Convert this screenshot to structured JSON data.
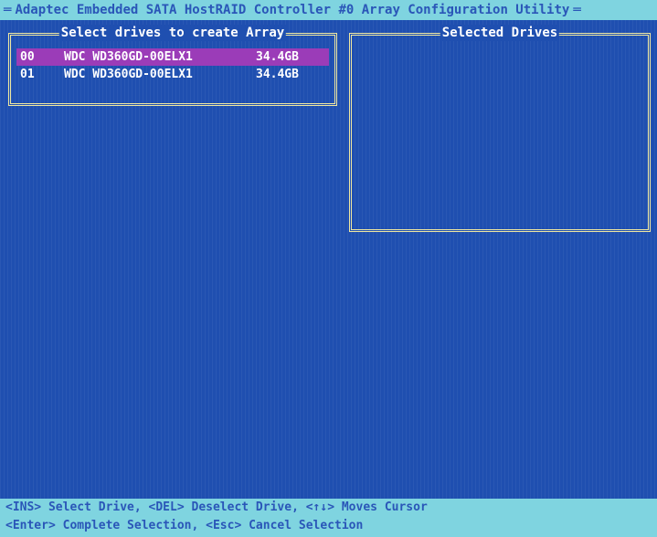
{
  "title_bar": {
    "text": "Adaptec Embedded SATA HostRAID Controller #0 Array Configuration Utility"
  },
  "left_panel": {
    "title": "Select drives to create Array",
    "drives": [
      {
        "id": "00",
        "model": "WDC WD360GD-00ELX1",
        "size": "34.4GB",
        "selected": true
      },
      {
        "id": "01",
        "model": "WDC WD360GD-00ELX1",
        "size": "34.4GB",
        "selected": false
      }
    ]
  },
  "right_panel": {
    "title": "Selected Drives"
  },
  "help": {
    "line1": "<INS> Select Drive, <DEL> Deselect Drive, <↑↓> Moves Cursor",
    "line2": "<Enter> Complete Selection, <Esc> Cancel Selection"
  },
  "colors": {
    "background": "#1f4fb0",
    "bar": "#7fd4e0",
    "highlight": "#9b3cb8",
    "border": "#f0e8a0"
  }
}
